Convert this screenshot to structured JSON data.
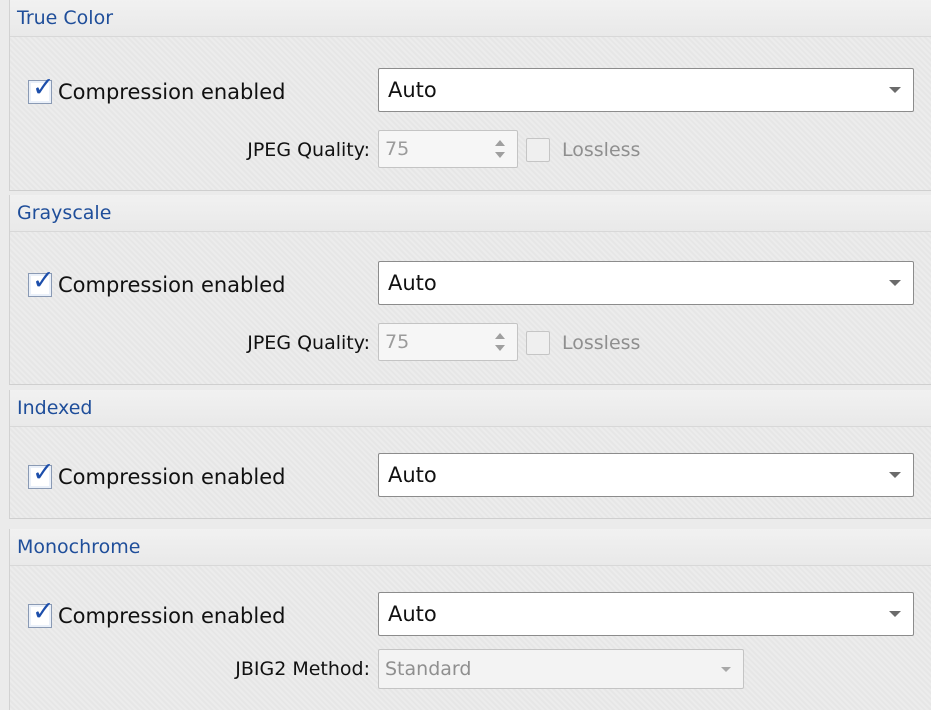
{
  "sections": [
    {
      "title": "True Color",
      "compression_label": "Compression enabled",
      "compression_checked": true,
      "method_value": "Auto",
      "quality_label": "JPEG Quality:",
      "quality_value": "75",
      "lossless_label": "Lossless",
      "lossless_checked": false
    },
    {
      "title": "Grayscale",
      "compression_label": "Compression enabled",
      "compression_checked": true,
      "method_value": "Auto",
      "quality_label": "JPEG Quality:",
      "quality_value": "75",
      "lossless_label": "Lossless",
      "lossless_checked": false
    },
    {
      "title": "Indexed",
      "compression_label": "Compression enabled",
      "compression_checked": true,
      "method_value": "Auto"
    },
    {
      "title": "Monochrome",
      "compression_label": "Compression enabled",
      "compression_checked": true,
      "method_value": "Auto",
      "jbig2_label": "JBIG2 Method:",
      "jbig2_value": "Standard"
    }
  ],
  "icons": {
    "checkbox_check": "✓",
    "combo_arrow": "chevron-down-icon",
    "spin": "spinner-arrows-icon"
  },
  "colors": {
    "section_title": "#1f4e9a",
    "check": "#1c4eab",
    "disabled_text": "#9b9b9b"
  }
}
